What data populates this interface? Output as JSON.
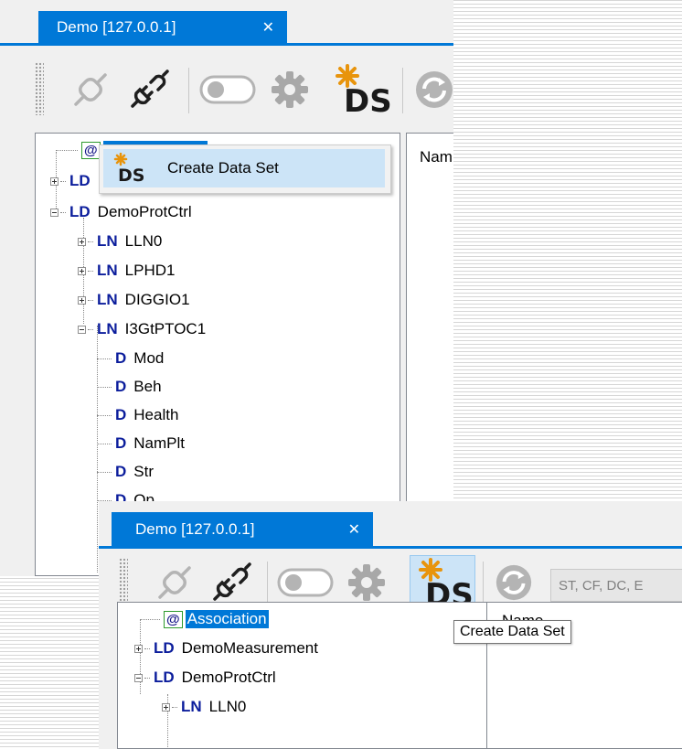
{
  "colors": {
    "accent": "#0078d7",
    "ds_star": "#e8940c",
    "tag_blue": "#0b1d9c",
    "selection": "#0078d7"
  },
  "back_window": {
    "tab_title": "Demo [127.0.0.1]",
    "tab_close": "✕",
    "toolbar": {
      "buttons": [
        {
          "icon": "connect-plug-icon",
          "label": "Connect"
        },
        {
          "icon": "disconnect-plug-icon",
          "label": "Disconnect"
        },
        {
          "icon": "toggle-switch-icon",
          "label": "Toggle"
        },
        {
          "icon": "gear-icon",
          "label": "Settings"
        },
        {
          "icon": "create-dataset-icon",
          "label": "DS"
        },
        {
          "icon": "refresh-icon",
          "label": "Refresh"
        }
      ]
    },
    "tree": {
      "association": "@",
      "nodes": [
        {
          "tag": "LD",
          "name": ""
        },
        {
          "tag": "LD",
          "name": "DemoProtCtrl"
        },
        {
          "tag": "LN",
          "name": "LLN0"
        },
        {
          "tag": "LN",
          "name": "LPHD1"
        },
        {
          "tag": "LN",
          "name": "DIGGIO1"
        },
        {
          "tag": "LN",
          "name": "I3GtPTOC1"
        },
        {
          "tag": "D",
          "name": "Mod"
        },
        {
          "tag": "D",
          "name": "Beh"
        },
        {
          "tag": "D",
          "name": "Health"
        },
        {
          "tag": "D",
          "name": "NamPlt"
        },
        {
          "tag": "D",
          "name": "Str"
        },
        {
          "tag": "D",
          "name": "Op"
        }
      ]
    },
    "context_menu": {
      "icon": "create-dataset-icon",
      "ds_text": "DS",
      "label": "Create Data Set"
    },
    "right_panel_header": "Nam"
  },
  "front_window": {
    "tab_title": "Demo [127.0.0.1]",
    "tab_close": "✕",
    "toolbar": {
      "ds_text": "DS",
      "filter_text": "ST, CF, DC, E",
      "tooltip": "Create Data Set"
    },
    "tree": {
      "association_symbol": "@",
      "association_label": "Association",
      "nodes": [
        {
          "tag": "LD",
          "name": "DemoMeasurement"
        },
        {
          "tag": "LD",
          "name": "DemoProtCtrl"
        },
        {
          "tag": "LN",
          "name": "LLN0"
        }
      ]
    },
    "right_panel_header": "Name"
  }
}
